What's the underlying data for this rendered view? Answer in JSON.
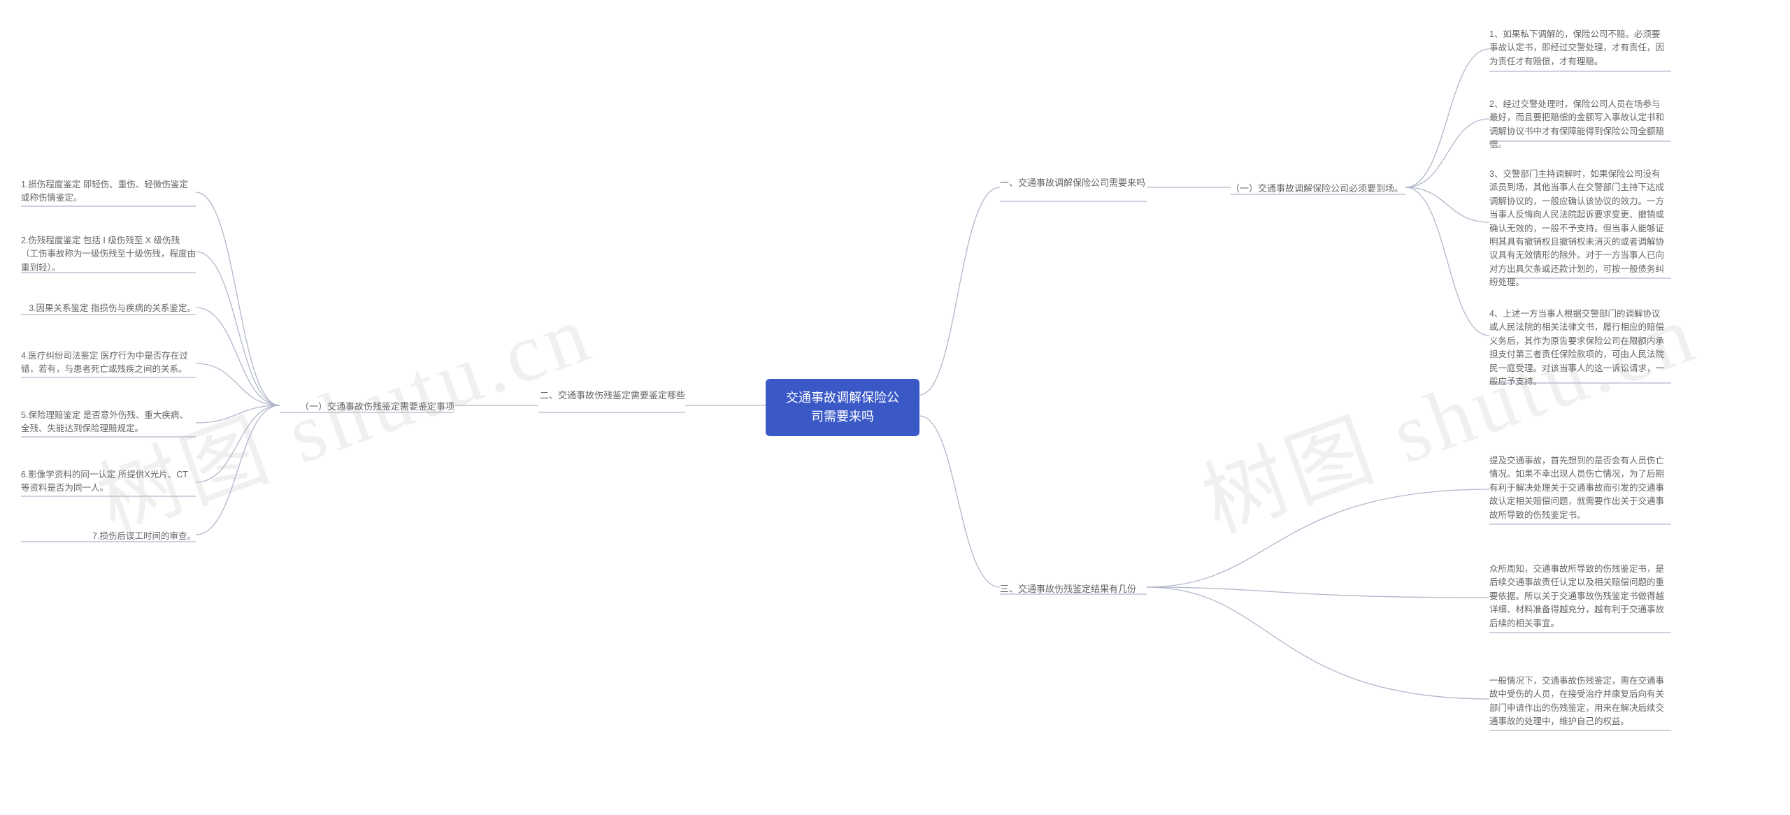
{
  "root": "交通事故调解保险公司需要来吗",
  "watermark": "树图 shutu.cn",
  "right": {
    "b1": {
      "label": "一、交通事故调解保险公司需要来吗",
      "s1": {
        "label": "（一）交通事故调解保险公司必须要到场。",
        "leaves": [
          "1、如果私下调解的，保险公司不赔。必须要事故认定书，即经过交警处理，才有责任，因为责任才有赔偿，才有理赔。",
          "2、经过交警处理时，保险公司人员在场参与最好，而且要把赔偿的金额写入事故认定书和调解协议书中才有保障能得到保险公司全额赔偿。",
          "3、交警部门主持调解时，如果保险公司没有派员到场，其他当事人在交警部门主持下达成调解协议的，一般应确认该协议的效力。一方当事人反悔向人民法院起诉要求变更、撤销或确认无效的，一般不予支持。但当事人能够证明其具有撤销权且撤销权未消灭的或者调解协议具有无效情形的除外。对于一方当事人已向对方出具欠条或还款计划的，可按一般债务纠纷处理。",
          "4、上述一方当事人根据交警部门的调解协议或人民法院的相关法律文书，履行相应的赔偿义务后，其作为原告要求保险公司在限额内承担支付第三者责任保险款项的，可由人民法院民一庭受理。对该当事人的这一诉讼请求，一般应予支持。"
        ]
      }
    },
    "b3": {
      "label": "三、交通事故伤残鉴定结果有几份",
      "leaves": [
        "提及交通事故，首先想到的是否会有人员伤亡情况。如果不幸出现人员伤亡情况，为了后期有利于解决处理关于交通事故而引发的交通事故认定相关赔偿问题，就需要作出关于交通事故所导致的伤残鉴定书。",
        "众所周知，交通事故所导致的伤残鉴定书，是后续交通事故责任认定以及相关赔偿问题的重要依据。所以关于交通事故伤残鉴定书做得越详细、材料准备得越充分，越有利于交通事故后续的相关事宜。",
        "一般情况下，交通事故伤残鉴定，需在交通事故中受伤的人员，在接受治疗并康复后向有关部门申请作出的伤残鉴定，用来在解决后续交通事故的处理中，维护自己的权益。"
      ]
    }
  },
  "left": {
    "b2": {
      "label": "二、交通事故伤残鉴定需要鉴定哪些",
      "s1": {
        "label": "（一）交通事故伤残鉴定需要鉴定事项",
        "leaves": [
          "1.损伤程度鉴定 即轻伤、重伤、轻微伤鉴定或称伤情鉴定。",
          "2.伤残程度鉴定 包括 I 级伤残至 X 级伤残（工伤事故称为一级伤残至十级伤残，程度由重到轻）。",
          "3.因果关系鉴定 指损伤与疾病的关系鉴定。",
          "4.医疗纠纷司法鉴定 医疗行为中是否存在过错，若有，与患者死亡或残疾之间的关系。",
          "5.保险理赔鉴定 是否意外伤残、重大疾病、全残、失能达到保险理赔规定。",
          "6.影像学资料的同一认定 所提供X光片、CT等资料是否为同一人。",
          "7.损伤后误工时间的审查。"
        ]
      }
    }
  }
}
